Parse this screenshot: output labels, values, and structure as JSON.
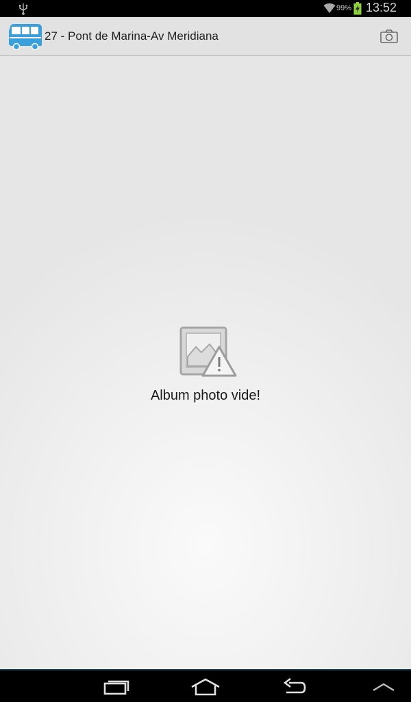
{
  "status_bar": {
    "battery_percent": "99%",
    "time": "13:52",
    "icons": [
      "usb-icon",
      "wifi-icon",
      "battery-charging-icon"
    ]
  },
  "action_bar": {
    "app_icon": "bus-icon",
    "title": "27 - Pont de Marina-Av Meridiana",
    "action_icon": "camera-icon",
    "brand_color": "#3aa0dc"
  },
  "content": {
    "empty_icon": "image-warning-icon",
    "empty_message": "Album photo vide!"
  },
  "nav_bar": {
    "buttons": [
      "recent-apps-icon",
      "home-icon",
      "back-icon",
      "menu-up-icon"
    ]
  }
}
